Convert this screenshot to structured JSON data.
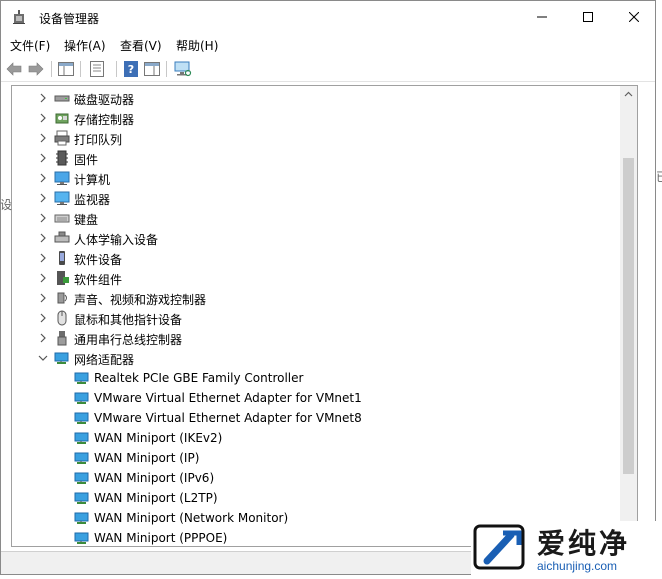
{
  "window": {
    "title": "设备管理器"
  },
  "menu": [
    {
      "label": "文件(F)"
    },
    {
      "label": "操作(A)"
    },
    {
      "label": "查看(V)"
    },
    {
      "label": "帮助(H)"
    }
  ],
  "toolbar": {
    "buttons": [
      "back-arrow-icon",
      "forward-arrow-icon",
      "show-hide-console-tree-icon",
      "properties-icon",
      "help-icon",
      "action-pane-icon",
      "scan-hardware-icon"
    ]
  },
  "tree": {
    "categories": [
      {
        "label": "磁盘驱动器",
        "icon": "disk-drive-icon",
        "expanded": false
      },
      {
        "label": "存储控制器",
        "icon": "storage-controller-icon",
        "expanded": false
      },
      {
        "label": "打印队列",
        "icon": "printer-icon",
        "expanded": false
      },
      {
        "label": "固件",
        "icon": "firmware-icon",
        "expanded": false
      },
      {
        "label": "计算机",
        "icon": "computer-icon",
        "expanded": false
      },
      {
        "label": "监视器",
        "icon": "monitor-icon",
        "expanded": false
      },
      {
        "label": "键盘",
        "icon": "keyboard-icon",
        "expanded": false
      },
      {
        "label": "人体学输入设备",
        "icon": "hid-icon",
        "expanded": false
      },
      {
        "label": "软件设备",
        "icon": "software-device-icon",
        "expanded": false
      },
      {
        "label": "软件组件",
        "icon": "software-component-icon",
        "expanded": false
      },
      {
        "label": "声音、视频和游戏控制器",
        "icon": "speaker-icon",
        "expanded": false
      },
      {
        "label": "鼠标和其他指针设备",
        "icon": "mouse-icon",
        "expanded": false
      },
      {
        "label": "通用串行总线控制器",
        "icon": "usb-icon",
        "expanded": false
      },
      {
        "label": "网络适配器",
        "icon": "network-adapter-icon",
        "expanded": true
      }
    ],
    "network_adapters": [
      "Realtek PCIe GBE Family Controller",
      "VMware Virtual Ethernet Adapter for VMnet1",
      "VMware Virtual Ethernet Adapter for VMnet8",
      "WAN Miniport (IKEv2)",
      "WAN Miniport (IP)",
      "WAN Miniport (IPv6)",
      "WAN Miniport (L2TP)",
      "WAN Miniport (Network Monitor)",
      "WAN Miniport (PPPOE)"
    ],
    "scroll_position": 0.5
  },
  "background_fragments": {
    "left": "设",
    "right": "已"
  },
  "watermark": {
    "name": "爱纯净",
    "url": "aichunjing.com"
  }
}
